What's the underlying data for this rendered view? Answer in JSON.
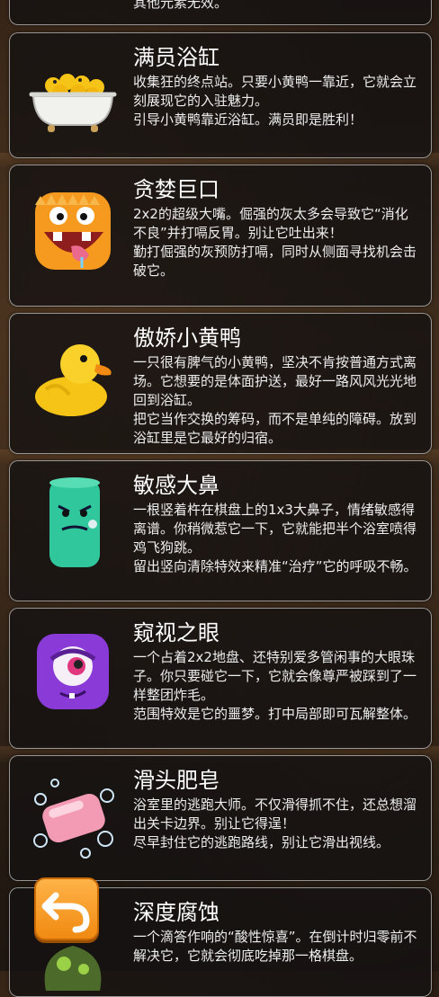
{
  "top_fragment": "其他元素无效。",
  "cards": [
    {
      "title": "满员浴缸",
      "lines": [
        "收集狂的终点站。只要小黄鸭一靠近，它就会立刻展现它的入驻魅力。",
        "引导小黄鸭靠近浴缸。满员即是胜利！"
      ],
      "icon": "bathtub-ducks-icon"
    },
    {
      "title": "贪婪巨口",
      "lines": [
        "2x2的超级大嘴。倔强的灰太多会导致它“消化不良”并打嗝反胃。别让它吐出来！",
        "勤打倔强的灰预防打嗝，同时从侧面寻找机会击破它。"
      ],
      "icon": "greedy-mouth-monster-icon"
    },
    {
      "title": "傲娇小黄鸭",
      "lines": [
        "一只很有脾气的小黄鸭，坚决不肯按普通方式离场。它想要的是体面护送，最好一路风风光光地回到浴缸。",
        "把它当作交换的筹码，而不是单纯的障碍。放到浴缸里是它最好的归宿。"
      ],
      "icon": "rubber-duck-icon"
    },
    {
      "title": "敏感大鼻",
      "lines": [
        "一根竖着杵在棋盘上的1x3大鼻子，情绪敏感得离谱。你稍微惹它一下，它就能把半个浴室喷得鸡飞狗跳。",
        "留出竖向清除特效来精准“治疗”它的呼吸不畅。"
      ],
      "icon": "green-nose-monster-icon"
    },
    {
      "title": "窥视之眼",
      "lines": [
        "一个占着2x2地盘、还特别爱多管闲事的大眼珠子。你只要碰它一下，它就会像尊严被踩到了一样整团炸毛。",
        "范围特效是它的噩梦。打中局部即可瓦解整体。"
      ],
      "icon": "purple-eye-monster-icon"
    },
    {
      "title": "滑头肥皂",
      "lines": [
        "浴室里的逃跑大师。不仅滑得抓不住，还总想溜出关卡边界。别让它得逞！",
        "尽早封住它的逃跑路线，别让它滑出视线。"
      ],
      "icon": "soap-bubbles-icon"
    },
    {
      "title": "深度腐蚀",
      "lines": [
        "一个滴答作响的“酸性惊喜”。在倒计时归零前不解决它，它就会彻底吃掉那一格棋盘。"
      ],
      "icon": "acid-blob-icon"
    }
  ],
  "back_button": {
    "icon": "back-arrow-icon"
  },
  "colors": {
    "card_bg": "#141212",
    "card_border": "#ffffff",
    "back_button": "#f59a1a"
  }
}
